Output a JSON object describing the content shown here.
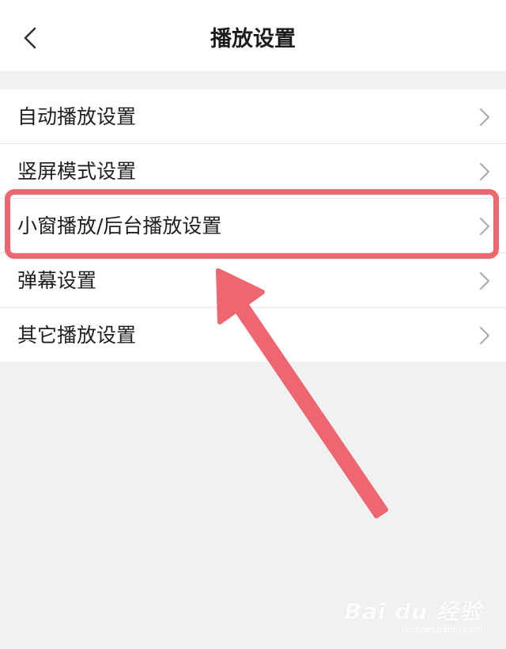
{
  "header": {
    "title": "播放设置",
    "back_icon": "chevron-left-icon"
  },
  "settings": {
    "items": [
      {
        "label": "自动播放设置"
      },
      {
        "label": "竖屏模式设置"
      },
      {
        "label": "小窗播放/后台播放设置",
        "highlighted": true
      },
      {
        "label": "弹幕设置"
      },
      {
        "label": "其它播放设置"
      }
    ]
  },
  "annotation": {
    "color": "#ee6670",
    "highlighted_item": "小窗播放/后台播放设置"
  },
  "watermark": {
    "logo": "Bai du 经验",
    "url": "jingyan.baidu.com"
  },
  "colors": {
    "background": "#f0f1f3",
    "surface": "#ffffff",
    "text": "#1f1f1f",
    "chevron": "#a9a9a9",
    "divider": "#e6e6e6"
  }
}
